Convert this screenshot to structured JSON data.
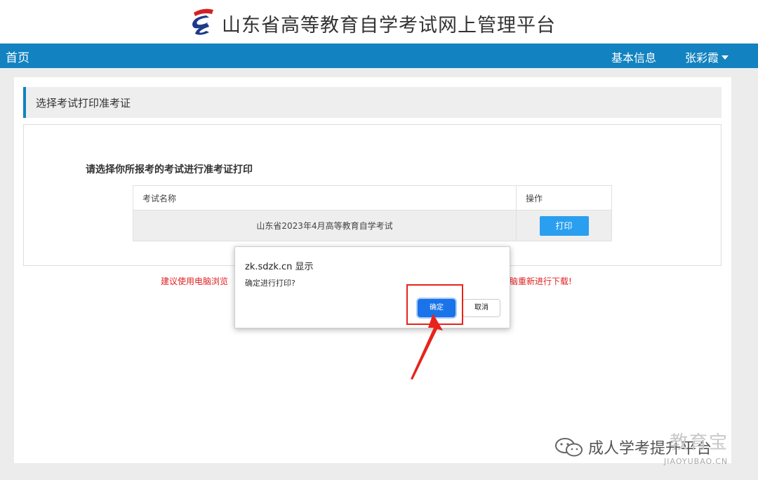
{
  "header": {
    "site_title": "山东省高等教育自学考试网上管理平台"
  },
  "nav": {
    "home": "首页",
    "basic_info": "基本信息",
    "user_name": "张彩霞"
  },
  "panel": {
    "heading": "选择考试打印准考证",
    "instruction": "请选择你所报考的考试进行准考证打印",
    "table": {
      "headers": [
        "考试名称",
        "操作"
      ],
      "rows": [
        {
          "exam_name": "山东省2023年4月高等教育自学考试",
          "action": "打印"
        }
      ]
    }
  },
  "notice": {
    "left_fragment": "建议使用电脑浏览",
    "right_fragment": "脑重新进行下载!"
  },
  "dialog": {
    "title": "zk.sdzk.cn 显示",
    "message": "确定进行打印?",
    "ok": "确定",
    "cancel": "取消"
  },
  "watermark": {
    "text": "成人学考提升平台",
    "brand": "教育宝",
    "domain": "JIAOYUBAO.CN"
  },
  "colors": {
    "nav_bg": "#1282c0",
    "print_button": "#2a9ff0",
    "ok_button": "#1a73e8",
    "notice_red": "#e02020",
    "highlight_red": "#e8231b"
  }
}
